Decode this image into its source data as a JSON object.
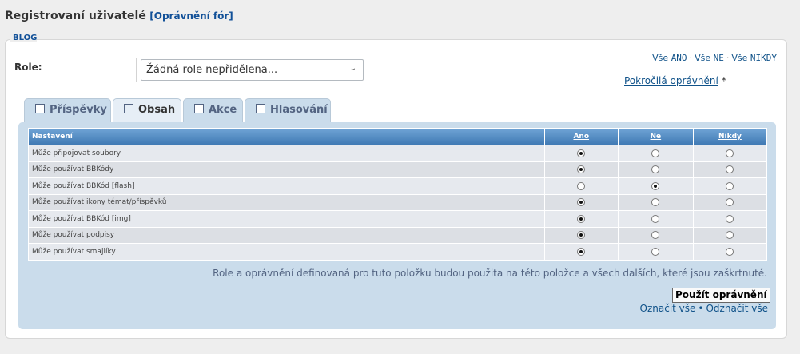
{
  "header": {
    "title": "Registrovaní uživatelé",
    "subtitle": "[Oprávnění fór]"
  },
  "fieldset": {
    "legend": "BLOG"
  },
  "role": {
    "label": "Role:",
    "selected": "Žádná role nepřidělena..."
  },
  "top_links": {
    "all_yes_prefix": "Vše",
    "all_yes_word": "ANO",
    "all_no_prefix": "Vše",
    "all_no_word": "NE",
    "all_never_prefix": "Vše",
    "all_never_word": "NIKDY",
    "separator": "·",
    "advanced": "Pokročilá oprávnění",
    "advanced_star": "*"
  },
  "tabs": [
    {
      "label": "Příspěvky",
      "active": false
    },
    {
      "label": "Obsah",
      "active": true
    },
    {
      "label": "Akce",
      "active": false
    },
    {
      "label": "Hlasování",
      "active": false
    }
  ],
  "table": {
    "headers": {
      "setting": "Nastavení",
      "yes": "Ano",
      "no": "Ne",
      "never": "Nikdy"
    },
    "rows": [
      {
        "label": "Může připojovat soubory",
        "value": "yes"
      },
      {
        "label": "Může používat BBKódy",
        "value": "yes"
      },
      {
        "label": "Může používat BBKód [flash]",
        "value": "no"
      },
      {
        "label": "Může používat ikony témat/příspěvků",
        "value": "yes"
      },
      {
        "label": "Může používat BBKód [img]",
        "value": "yes"
      },
      {
        "label": "Může používat podpisy",
        "value": "yes"
      },
      {
        "label": "Může používat smajlíky",
        "value": "yes"
      }
    ]
  },
  "footer": {
    "note": "Role a oprávnění definovaná pro tuto položku budou použita na této položce a všech dalších, které jsou zaškrtnuté.",
    "apply_button": "Použít oprávnění",
    "mark_all": "Označit vše",
    "mark_sep": "•",
    "unmark_all": "Odznačit vše"
  }
}
